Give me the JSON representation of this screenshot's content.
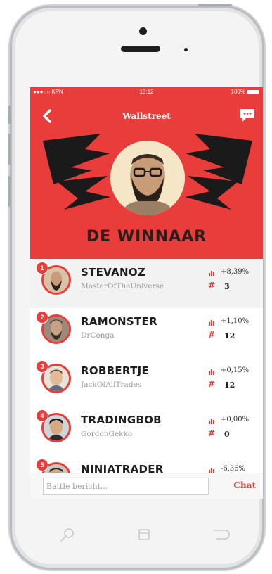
{
  "status_bar": {
    "carrier": "●●●○○ KPN",
    "time": "13:12",
    "battery": "100%"
  },
  "nav": {
    "title": "Wallstreet",
    "back_icon": "chevron-left-icon",
    "chat_icon": "speech-bubble-icon"
  },
  "hero": {
    "title": "DE WINNAAR"
  },
  "leaderboard": [
    {
      "rank": "1",
      "username": "STEVANOZ",
      "handle": "MasterOfTheUniverse",
      "change": "+8,39%",
      "trades": "3"
    },
    {
      "rank": "2",
      "username": "RAMONSTER",
      "handle": "DrConga",
      "change": "+1,10%",
      "trades": "12"
    },
    {
      "rank": "3",
      "username": "ROBBERTJE",
      "handle": "JackOfAllTrades",
      "change": "+0,15%",
      "trades": "12"
    },
    {
      "rank": "4",
      "username": "TRADINGBOB",
      "handle": "GordonGekko",
      "change": "+0,00%",
      "trades": "0"
    },
    {
      "rank": "5",
      "username": "NINJATRADER",
      "handle": "",
      "change": "-6,36%",
      "trades": ""
    }
  ],
  "compose": {
    "placeholder": "Battle bericht...",
    "send_label": "Chat"
  },
  "hash_symbol": "#",
  "colors": {
    "accent": "#e83d3b",
    "hero_text": "#2a1d1d"
  },
  "home_buttons": [
    "search-icon",
    "square-icon",
    "back-arrow-icon"
  ]
}
